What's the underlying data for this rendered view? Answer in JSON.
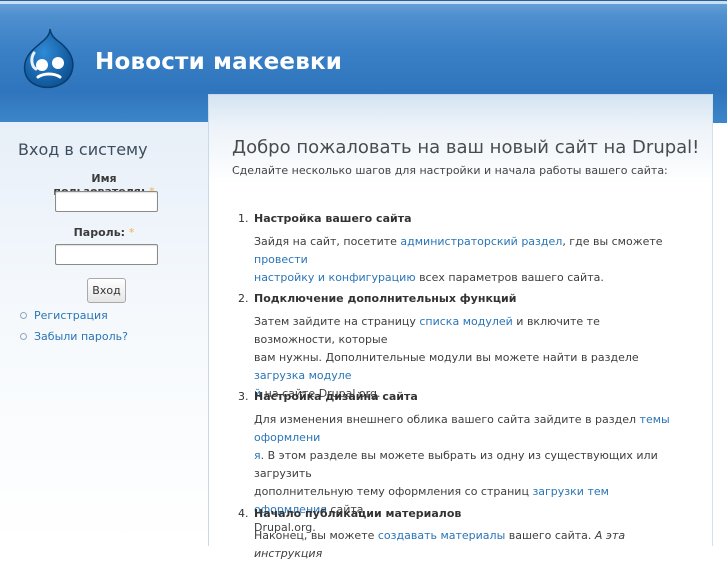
{
  "site": {
    "name": "Новости макеевки",
    "logo_icon": "drupal-drop-icon"
  },
  "colors": {
    "header_blue": "#3a80c6",
    "link": "#2a75b6",
    "required_marker": "#f2b14a"
  },
  "login": {
    "title": "Вход в систему",
    "username_label": "Имя пользователя:",
    "password_label": "Пароль:",
    "required_marker": "*",
    "username_value": "",
    "password_value": "",
    "submit_label": "Вход",
    "links": [
      {
        "label": "Регистрация"
      },
      {
        "label": "Забыли пароль?"
      }
    ]
  },
  "main": {
    "title": "Добро пожаловать на ваш новый сайт на Drupal!",
    "intro": "Сделайте несколько шагов для настройки и начала работы вашего сайта:",
    "steps": [
      {
        "num": "1.",
        "title": "Настройка вашего сайта",
        "t1": "Зайдя на сайт, посетите ",
        "l1": "администраторский раздел",
        "t2": ", где вы сможете ",
        "l2a": "провести",
        "l2b": "настройку и конфигурацию",
        "t3": " всех параметров вашего сайта."
      },
      {
        "num": "2.",
        "title": "Подключение дополнительных функций",
        "t1": "Затем зайдите на страницу ",
        "l1": "списка модулей",
        "t2": " и включите те возможности, которые",
        "t3": "вам нужны. Дополнительные модули вы можете найти в разделе ",
        "l2a": "загрузка модуле",
        "l2b": "й",
        "t4": " на сайте Drupal.org."
      },
      {
        "num": "3.",
        "title": "Настройка дизайна сайта",
        "t1": "Для изменения внешнего облика вашего сайта зайдите в раздел ",
        "l1a": "темы оформлени",
        "l1b": "я",
        "t2": ". В этом разделе вы можете выбрать из одну из существующих или загрузить",
        "t3": "дополнительную тему оформления со страниц ",
        "l2": "загрузки тем оформления",
        "t4": " сайта",
        "t5": "Drupal.org."
      },
      {
        "num": "4.",
        "title": "Начало публикации материалов",
        "t1": "Наконец, вы можете ",
        "l1": "создавать материалы",
        "t2": " вашего сайта. ",
        "t3": "А эта инструкция"
      }
    ]
  }
}
